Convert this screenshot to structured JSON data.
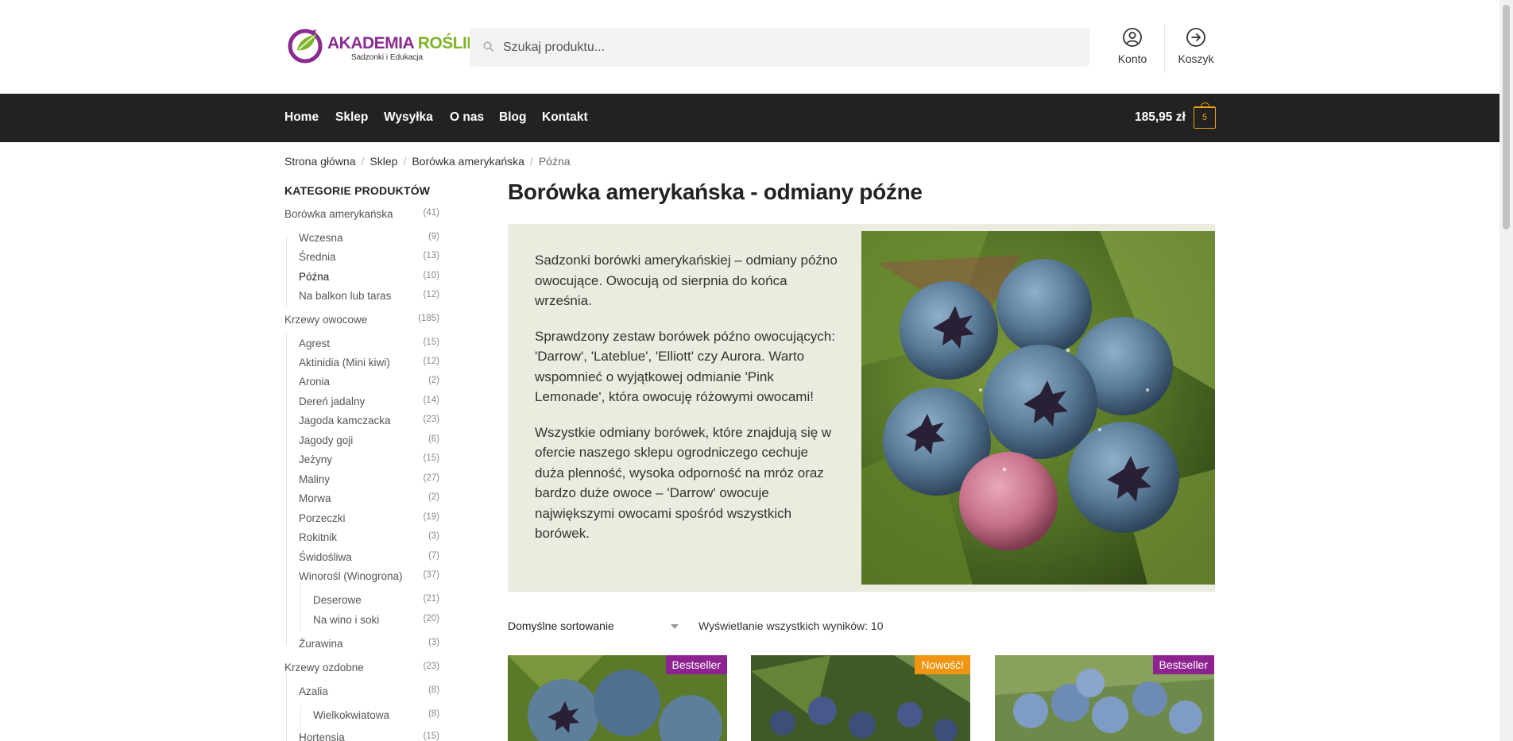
{
  "brand": {
    "name_part1": "AKADEMIA ",
    "name_part2": "ROŚLIN",
    "tagline": "Sadzonki i Edukacja",
    "colors": {
      "purple": "#8a2b8f",
      "green": "#7fb42b"
    }
  },
  "search": {
    "placeholder": "Szukaj produktu..."
  },
  "header_actions": {
    "account_label": "Konto",
    "cart_label": "Koszyk"
  },
  "nav": {
    "items": [
      "Home",
      "Sklep",
      "Wysyłka",
      "O nas",
      "Blog",
      "Kontakt"
    ],
    "cart_total": "185,95 zł",
    "cart_count": "5"
  },
  "breadcrumb": [
    "Strona główna",
    "Sklep",
    "Borówka amerykańska",
    "Późna"
  ],
  "sidebar": {
    "heading": "KATEGORIE PRODUKTÓW",
    "categories": [
      {
        "name": "Borówka amerykańska",
        "count": "(41)"
      },
      {
        "name": "Wczesna",
        "count": "(9)"
      },
      {
        "name": "Średnia",
        "count": "(13)"
      },
      {
        "name": "Późna",
        "count": "(10)"
      },
      {
        "name": "Na balkon lub taras",
        "count": "(12)"
      },
      {
        "name": "Krzewy owocowe",
        "count": "(185)"
      },
      {
        "name": "Agrest",
        "count": "(15)"
      },
      {
        "name": "Aktinidia (Mini kiwi)",
        "count": "(12)"
      },
      {
        "name": "Aronia",
        "count": "(2)"
      },
      {
        "name": "Dereń jadalny",
        "count": "(14)"
      },
      {
        "name": "Jagoda kamczacka",
        "count": "(23)"
      },
      {
        "name": "Jagody goji",
        "count": "(6)"
      },
      {
        "name": "Jeżyny",
        "count": "(15)"
      },
      {
        "name": "Maliny",
        "count": "(27)"
      },
      {
        "name": "Morwa",
        "count": "(2)"
      },
      {
        "name": "Porzeczki",
        "count": "(19)"
      },
      {
        "name": "Rokitnik",
        "count": "(3)"
      },
      {
        "name": "Świdośliwa",
        "count": "(7)"
      },
      {
        "name": "Winorośl (Winogrona)",
        "count": "(37)"
      },
      {
        "name": "Deserowe",
        "count": "(21)"
      },
      {
        "name": "Na wino i soki",
        "count": "(20)"
      },
      {
        "name": "Żurawina",
        "count": "(3)"
      },
      {
        "name": "Krzewy ozdobne",
        "count": "(23)"
      },
      {
        "name": "Azalia",
        "count": "(8)"
      },
      {
        "name": "Wielkokwiatowa",
        "count": "(8)"
      },
      {
        "name": "Hortensja",
        "count": "(15)"
      }
    ]
  },
  "main": {
    "title": "Borówka amerykańska - odmiany późne",
    "intro_paragraphs": [
      "Sadzonki borówki amerykańskiej – odmiany późno owocujące. Owocują od sierpnia do końca września.",
      "Sprawdzony zestaw borówek późno owocujących: 'Darrow', 'Lateblue', 'Elliott' czy Aurora. Warto wspomnieć o wyjątkowej odmianie 'Pink Lemonade', która owocuję różowymi owocami!",
      "Wszystkie odmiany borówek, które znajdują się w ofercie naszego sklepu ogrodniczego cechuje duża plenność, wysoka odporność na mróz oraz bardzo duże owoce – 'Darrow' owocuje największymi owocami spośród wszystkich borówek."
    ],
    "sort_label": "Domyślne sortowanie",
    "results_text": "Wyświetlanie wszystkich wyników: 10",
    "product_badges": [
      "Bestseller",
      "Nowość!",
      "Bestseller"
    ],
    "badge_colors": {
      "bestseller": "#8d2290",
      "new": "#f19411"
    }
  },
  "icons": [
    "search-icon",
    "account-icon",
    "cart-arrow-icon",
    "bag-icon",
    "dropdown-chevron-icon"
  ]
}
